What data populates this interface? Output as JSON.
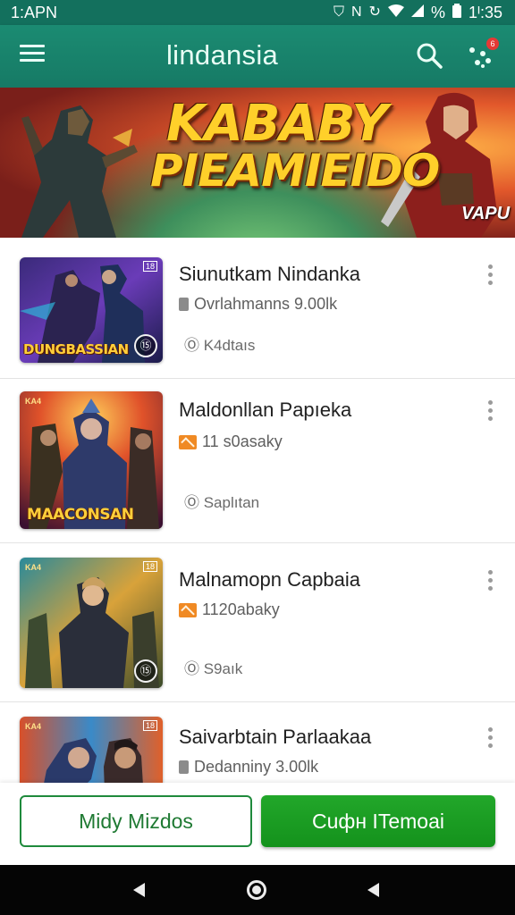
{
  "status_bar": {
    "time_left": "1:APN",
    "icons": [
      "vpn-icon",
      "nfc-icon",
      "sync-icon",
      "wifi-icon",
      "battery-icon"
    ],
    "battery_text": "%",
    "time_right": "1ᴵ:35"
  },
  "app_bar": {
    "title": "lindansia",
    "menu_icon": "hamburger-menu-icon",
    "search_icon": "search-icon",
    "notification_icon": "notification-icon",
    "badge": "6"
  },
  "banner": {
    "title_line1": "KABABY",
    "title_line2": "PIEAMIEIDO",
    "corner_text": "VAPU"
  },
  "items": [
    {
      "title": "Siunutkam Nindanka",
      "meta": "Ovrlahmanns 9.00lk",
      "meta_icon": "grey",
      "sub": "Ⓞ K4dtaıs",
      "thumb_caption": "DUNGBASSIAN",
      "thumb_badge": "⑮",
      "thumb_tag": "",
      "thumb_tag_r": "18"
    },
    {
      "title": "Maldonllan Papıeka",
      "meta": "11 s0asaky",
      "meta_icon": "orange",
      "sub": "Ⓞ Saplıtan",
      "thumb_caption": "MAACONSAN",
      "thumb_badge": "",
      "thumb_tag": "KA4",
      "thumb_tag_r": ""
    },
    {
      "title": "Malnamopn Capbaia",
      "meta": "1120abaky",
      "meta_icon": "orange",
      "sub": "Ⓞ S9aık",
      "thumb_caption": "",
      "thumb_badge": "⑮",
      "thumb_tag": "KA4",
      "thumb_tag_r": "18"
    },
    {
      "title": "Saivarbtain Parlaakaa",
      "meta": "Dedanniny 3.00lk",
      "meta_icon": "grey",
      "sub": "",
      "thumb_caption": "",
      "thumb_badge": "",
      "thumb_tag": "KA4",
      "thumb_tag_r": "18"
    }
  ],
  "actions": {
    "secondary": "Midy Mizdos",
    "primary": "Cuфн ITemoai"
  },
  "nav": {
    "back_icon": "back-triangle-icon",
    "home_icon": "home-circle-icon",
    "recent_icon": "recent-triangle-icon"
  },
  "colors": {
    "app_bar": "#167a65",
    "status_bar": "#13705d",
    "primary_button": "#14921c",
    "outline_button": "#1f8a3c"
  }
}
